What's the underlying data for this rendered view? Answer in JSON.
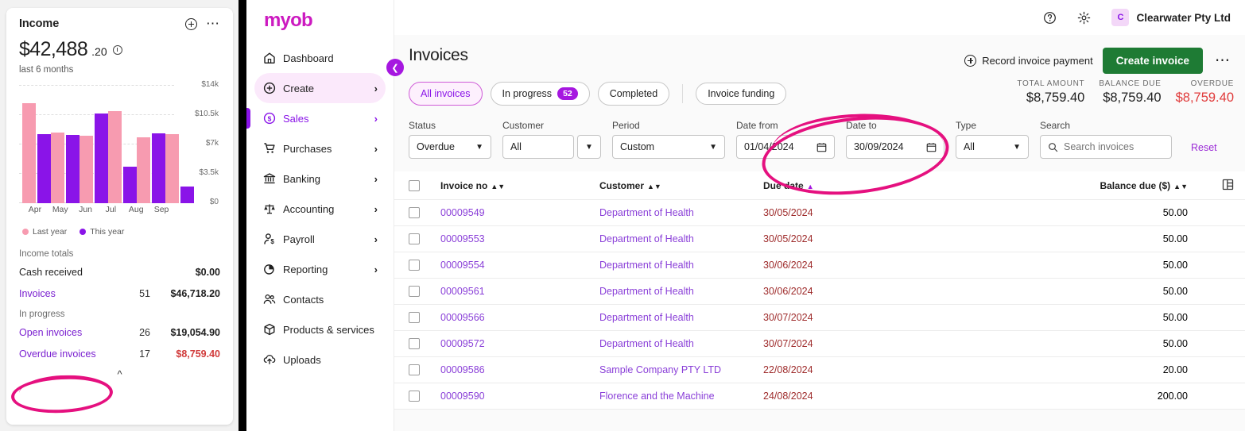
{
  "dashboard": {
    "card": {
      "title": "Income",
      "add_icon": "plus-circle-icon",
      "more_icon": "ellipsis-icon",
      "amount_main": "$42,488",
      "amount_cents": ".20",
      "info_icon": "info-icon",
      "subtitle": "last 6 months"
    },
    "legend": [
      {
        "label": "Last year",
        "color": "#f79bb0"
      },
      {
        "label": "This year",
        "color": "#8a14e8"
      }
    ],
    "income_totals": {
      "heading": "Income totals",
      "rows": [
        {
          "label": "Cash received",
          "count": "",
          "value": "$0.00",
          "link": false,
          "red": false
        },
        {
          "label": "Invoices",
          "count": "51",
          "value": "$46,718.20",
          "link": true,
          "red": false
        }
      ]
    },
    "in_progress": {
      "heading": "In progress",
      "rows": [
        {
          "label": "Open invoices",
          "count": "26",
          "value": "$19,054.90",
          "link": true,
          "red": false
        },
        {
          "label": "Overdue invoices",
          "count": "17",
          "value": "$8,759.40",
          "link": true,
          "red": true
        }
      ]
    },
    "collapse_chevron": "chevron-up-icon",
    "annotation_overdue": "pink-circle-highlight"
  },
  "chart_data": {
    "type": "bar",
    "title": "Income",
    "subtitle": "last 6 months",
    "categories": [
      "Apr",
      "May",
      "Jun",
      "Jul",
      "Aug",
      "Sep"
    ],
    "series": [
      {
        "name": "Last year",
        "color": "#f79bb0",
        "values": [
          11900,
          8400,
          8050,
          11000,
          7900,
          8250
        ]
      },
      {
        "name": "This year",
        "color": "#8a14e8",
        "values": [
          8250,
          8100,
          10650,
          4400,
          8350,
          2000
        ]
      }
    ],
    "ylabel": "",
    "xlabel": "",
    "ylim": [
      0,
      14000
    ],
    "ticks": [
      "$0",
      "$3.5k",
      "$7k",
      "$10.5k",
      "$14k"
    ],
    "tick_values": [
      0,
      3500,
      7000,
      10500,
      14000
    ],
    "grid": true,
    "legend_position": "bottom-left"
  },
  "topbar": {
    "help_icon": "help-circle-icon",
    "settings_icon": "gear-icon",
    "avatar_initial": "C",
    "company": "Clearwater Pty Ltd"
  },
  "sidebar": {
    "logo": "myob",
    "collapse_icon": "chevron-left-icon",
    "items": [
      {
        "label": "Dashboard",
        "icon": "home-icon",
        "chevron": "",
        "state": ""
      },
      {
        "label": "Create",
        "icon": "plus-circle-icon",
        "chevron": "›",
        "state": "highlighted"
      },
      {
        "label": "Sales",
        "icon": "dollar-circle-icon",
        "chevron": "›",
        "state": "active"
      },
      {
        "label": "Purchases",
        "icon": "cart-icon",
        "chevron": "›",
        "state": ""
      },
      {
        "label": "Banking",
        "icon": "bank-icon",
        "chevron": "›",
        "state": ""
      },
      {
        "label": "Accounting",
        "icon": "scales-icon",
        "chevron": "›",
        "state": ""
      },
      {
        "label": "Payroll",
        "icon": "person-dollar-icon",
        "chevron": "›",
        "state": ""
      },
      {
        "label": "Reporting",
        "icon": "pie-chart-icon",
        "chevron": "›",
        "state": ""
      },
      {
        "label": "Contacts",
        "icon": "people-icon",
        "chevron": "",
        "state": ""
      },
      {
        "label": "Products & services",
        "icon": "box-icon",
        "chevron": "",
        "state": ""
      },
      {
        "label": "Uploads",
        "icon": "cloud-upload-icon",
        "chevron": "",
        "state": ""
      }
    ]
  },
  "page": {
    "title": "Invoices",
    "record_payment_label": "Record invoice payment",
    "record_payment_icon": "plus-circle-icon",
    "create_invoice_label": "Create invoice",
    "more_icon": "ellipsis-icon",
    "tabs": [
      {
        "label": "All invoices",
        "badge": "",
        "selected": true
      },
      {
        "label": "In progress",
        "badge": "52",
        "selected": false
      },
      {
        "label": "Completed",
        "badge": "",
        "selected": false
      }
    ],
    "secondary_tab": {
      "label": "Invoice funding"
    },
    "totals": [
      {
        "label": "TOTAL AMOUNT",
        "value": "$8,759.40",
        "red": false
      },
      {
        "label": "BALANCE DUE",
        "value": "$8,759.40",
        "red": false
      },
      {
        "label": "OVERDUE",
        "value": "$8,759.40",
        "red": true
      }
    ]
  },
  "filters": {
    "status": {
      "label": "Status",
      "value": "Overdue"
    },
    "customer": {
      "label": "Customer",
      "value": "All",
      "dropdown_icon": "chevron-down-icon"
    },
    "period": {
      "label": "Period",
      "value": "Custom"
    },
    "date_from": {
      "label": "Date from",
      "value": "01/04/2024",
      "icon": "calendar-icon"
    },
    "date_to": {
      "label": "Date to",
      "value": "30/09/2024",
      "icon": "calendar-icon"
    },
    "type": {
      "label": "Type",
      "value": "All"
    },
    "search": {
      "label": "Search",
      "placeholder": "Search invoices",
      "value": "",
      "icon": "search-icon"
    },
    "reset_label": "Reset",
    "annotation": "pink-circle-highlight"
  },
  "table": {
    "columns_icon": "columns-settings-icon",
    "headers": [
      {
        "label": "Invoice no",
        "sort": "both"
      },
      {
        "label": "Customer",
        "sort": "both"
      },
      {
        "label": "Due date",
        "sort": "asc"
      },
      {
        "label": "Balance due ($)",
        "sort": "both"
      }
    ],
    "rows": [
      {
        "invoice_no": "00009549",
        "customer": "Department of Health",
        "due_date": "30/05/2024",
        "balance": "50.00"
      },
      {
        "invoice_no": "00009553",
        "customer": "Department of Health",
        "due_date": "30/05/2024",
        "balance": "50.00"
      },
      {
        "invoice_no": "00009554",
        "customer": "Department of Health",
        "due_date": "30/06/2024",
        "balance": "50.00"
      },
      {
        "invoice_no": "00009561",
        "customer": "Department of Health",
        "due_date": "30/06/2024",
        "balance": "50.00"
      },
      {
        "invoice_no": "00009566",
        "customer": "Department of Health",
        "due_date": "30/07/2024",
        "balance": "50.00"
      },
      {
        "invoice_no": "00009572",
        "customer": "Department of Health",
        "due_date": "30/07/2024",
        "balance": "50.00"
      },
      {
        "invoice_no": "00009586",
        "customer": "Sample Company PTY LTD",
        "due_date": "22/08/2024",
        "balance": "20.00"
      },
      {
        "invoice_no": "00009590",
        "customer": "Florence and the Machine",
        "due_date": "24/08/2024",
        "balance": "200.00"
      }
    ]
  },
  "colors": {
    "brand_purple": "#8a14e8",
    "logo_magenta": "#cc1ac0",
    "green": "#1e7b34",
    "red": "#e03a3a",
    "annotation_pink": "#e5107f",
    "last_year_pink": "#f79bb0"
  }
}
